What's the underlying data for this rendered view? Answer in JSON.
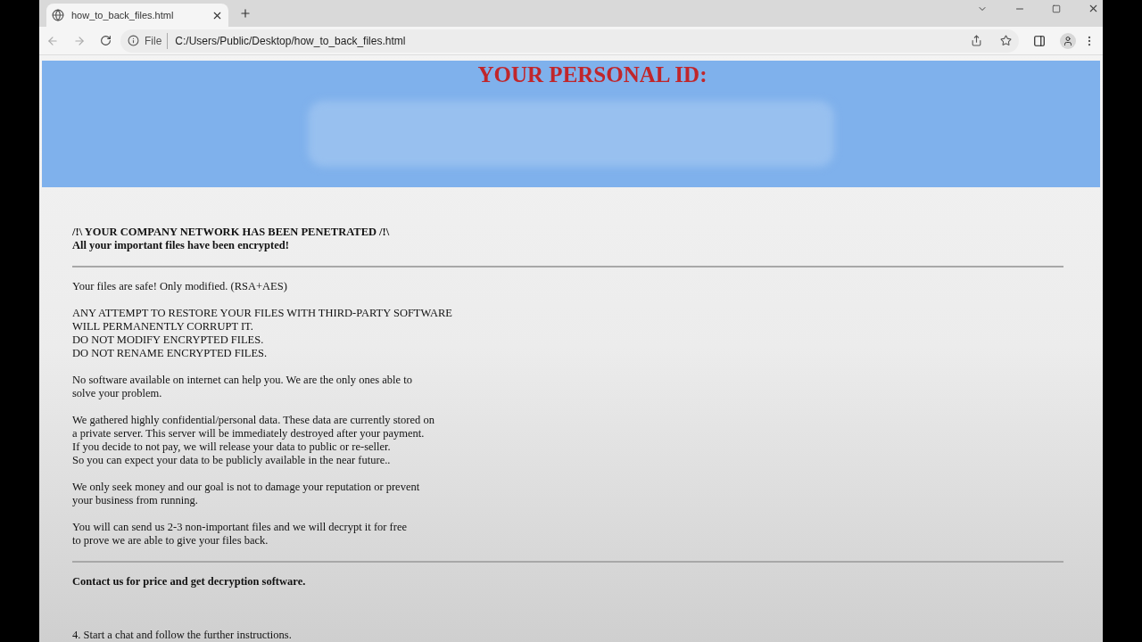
{
  "tab": {
    "title": "how_to_back_files.html",
    "selected": true
  },
  "address_bar": {
    "scheme": "File",
    "url": "C:/Users/Public/Desktop/how_to_back_files.html"
  },
  "page": {
    "header": {
      "title": "YOUR PERSONAL ID:",
      "redacted": true
    },
    "blocks": [
      {
        "kind": "bold",
        "lines": [
          "/!\\ YOUR COMPANY NETWORK HAS BEEN PENETRATED /!\\",
          "All your important files have been encrypted!"
        ]
      },
      {
        "kind": "rule"
      },
      {
        "kind": "text",
        "lines": [
          "Your files are safe! Only modified. (RSA+AES)"
        ]
      },
      {
        "kind": "text",
        "lines": [
          "ANY ATTEMPT TO RESTORE YOUR FILES WITH THIRD-PARTY SOFTWARE",
          "WILL PERMANENTLY CORRUPT IT.",
          "DO NOT MODIFY ENCRYPTED FILES.",
          "DO NOT RENAME ENCRYPTED FILES."
        ]
      },
      {
        "kind": "text",
        "lines": [
          "No software available on internet can help you. We are the only ones able to",
          "solve your problem."
        ]
      },
      {
        "kind": "text",
        "lines": [
          "We gathered highly confidential/personal data. These data are currently stored on",
          "a private server. This server will be immediately destroyed after your payment.",
          "If you decide to not pay, we will release your data to public or re-seller.",
          "So you can expect your data to be publicly available in the near future.."
        ]
      },
      {
        "kind": "text",
        "lines": [
          "We only seek money and our goal is not to damage your reputation or prevent",
          "your business from running."
        ]
      },
      {
        "kind": "text",
        "lines": [
          "You will can send us 2-3 non-important files and we will decrypt it for free",
          "to prove we are able to give your files back."
        ]
      },
      {
        "kind": "rule"
      },
      {
        "kind": "bold",
        "lines": [
          "Contact us for price and get decryption software."
        ]
      },
      {
        "kind": "spacer"
      },
      {
        "kind": "text",
        "lines": [
          "4. Start a chat and follow the further instructions."
        ]
      }
    ]
  }
}
